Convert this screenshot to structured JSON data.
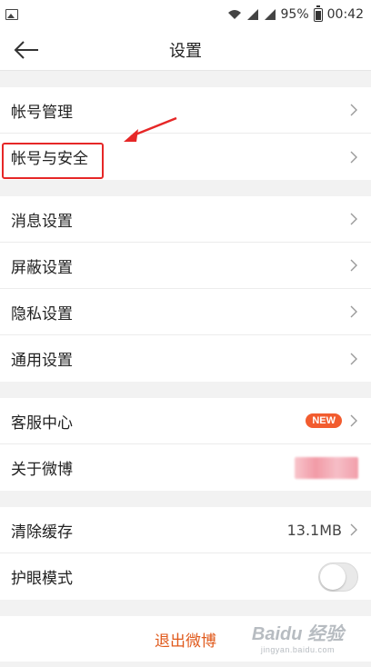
{
  "status_bar": {
    "battery_pct": "95%",
    "time": "00:42"
  },
  "header": {
    "title": "设置"
  },
  "groups": {
    "account": [
      {
        "label": "帐号管理"
      },
      {
        "label": "帐号与安全"
      }
    ],
    "settings": [
      {
        "label": "消息设置"
      },
      {
        "label": "屏蔽设置"
      },
      {
        "label": "隐私设置"
      },
      {
        "label": "通用设置"
      }
    ],
    "service": {
      "customer_service": {
        "label": "客服中心",
        "badge": "NEW"
      },
      "about": {
        "label": "关于微博"
      }
    },
    "misc": {
      "clear_cache": {
        "label": "清除缓存",
        "value": "13.1MB"
      },
      "eye_mode": {
        "label": "护眼模式",
        "toggle_on": false
      }
    }
  },
  "logout": {
    "label": "退出微博"
  },
  "watermark": {
    "main": "Baidu 经验",
    "sub": "jingyan.baidu.com"
  },
  "colors": {
    "accent": "#e05a1c",
    "badge": "#f25c2f",
    "highlight": "#e62727",
    "background": "#f2f2f2"
  }
}
